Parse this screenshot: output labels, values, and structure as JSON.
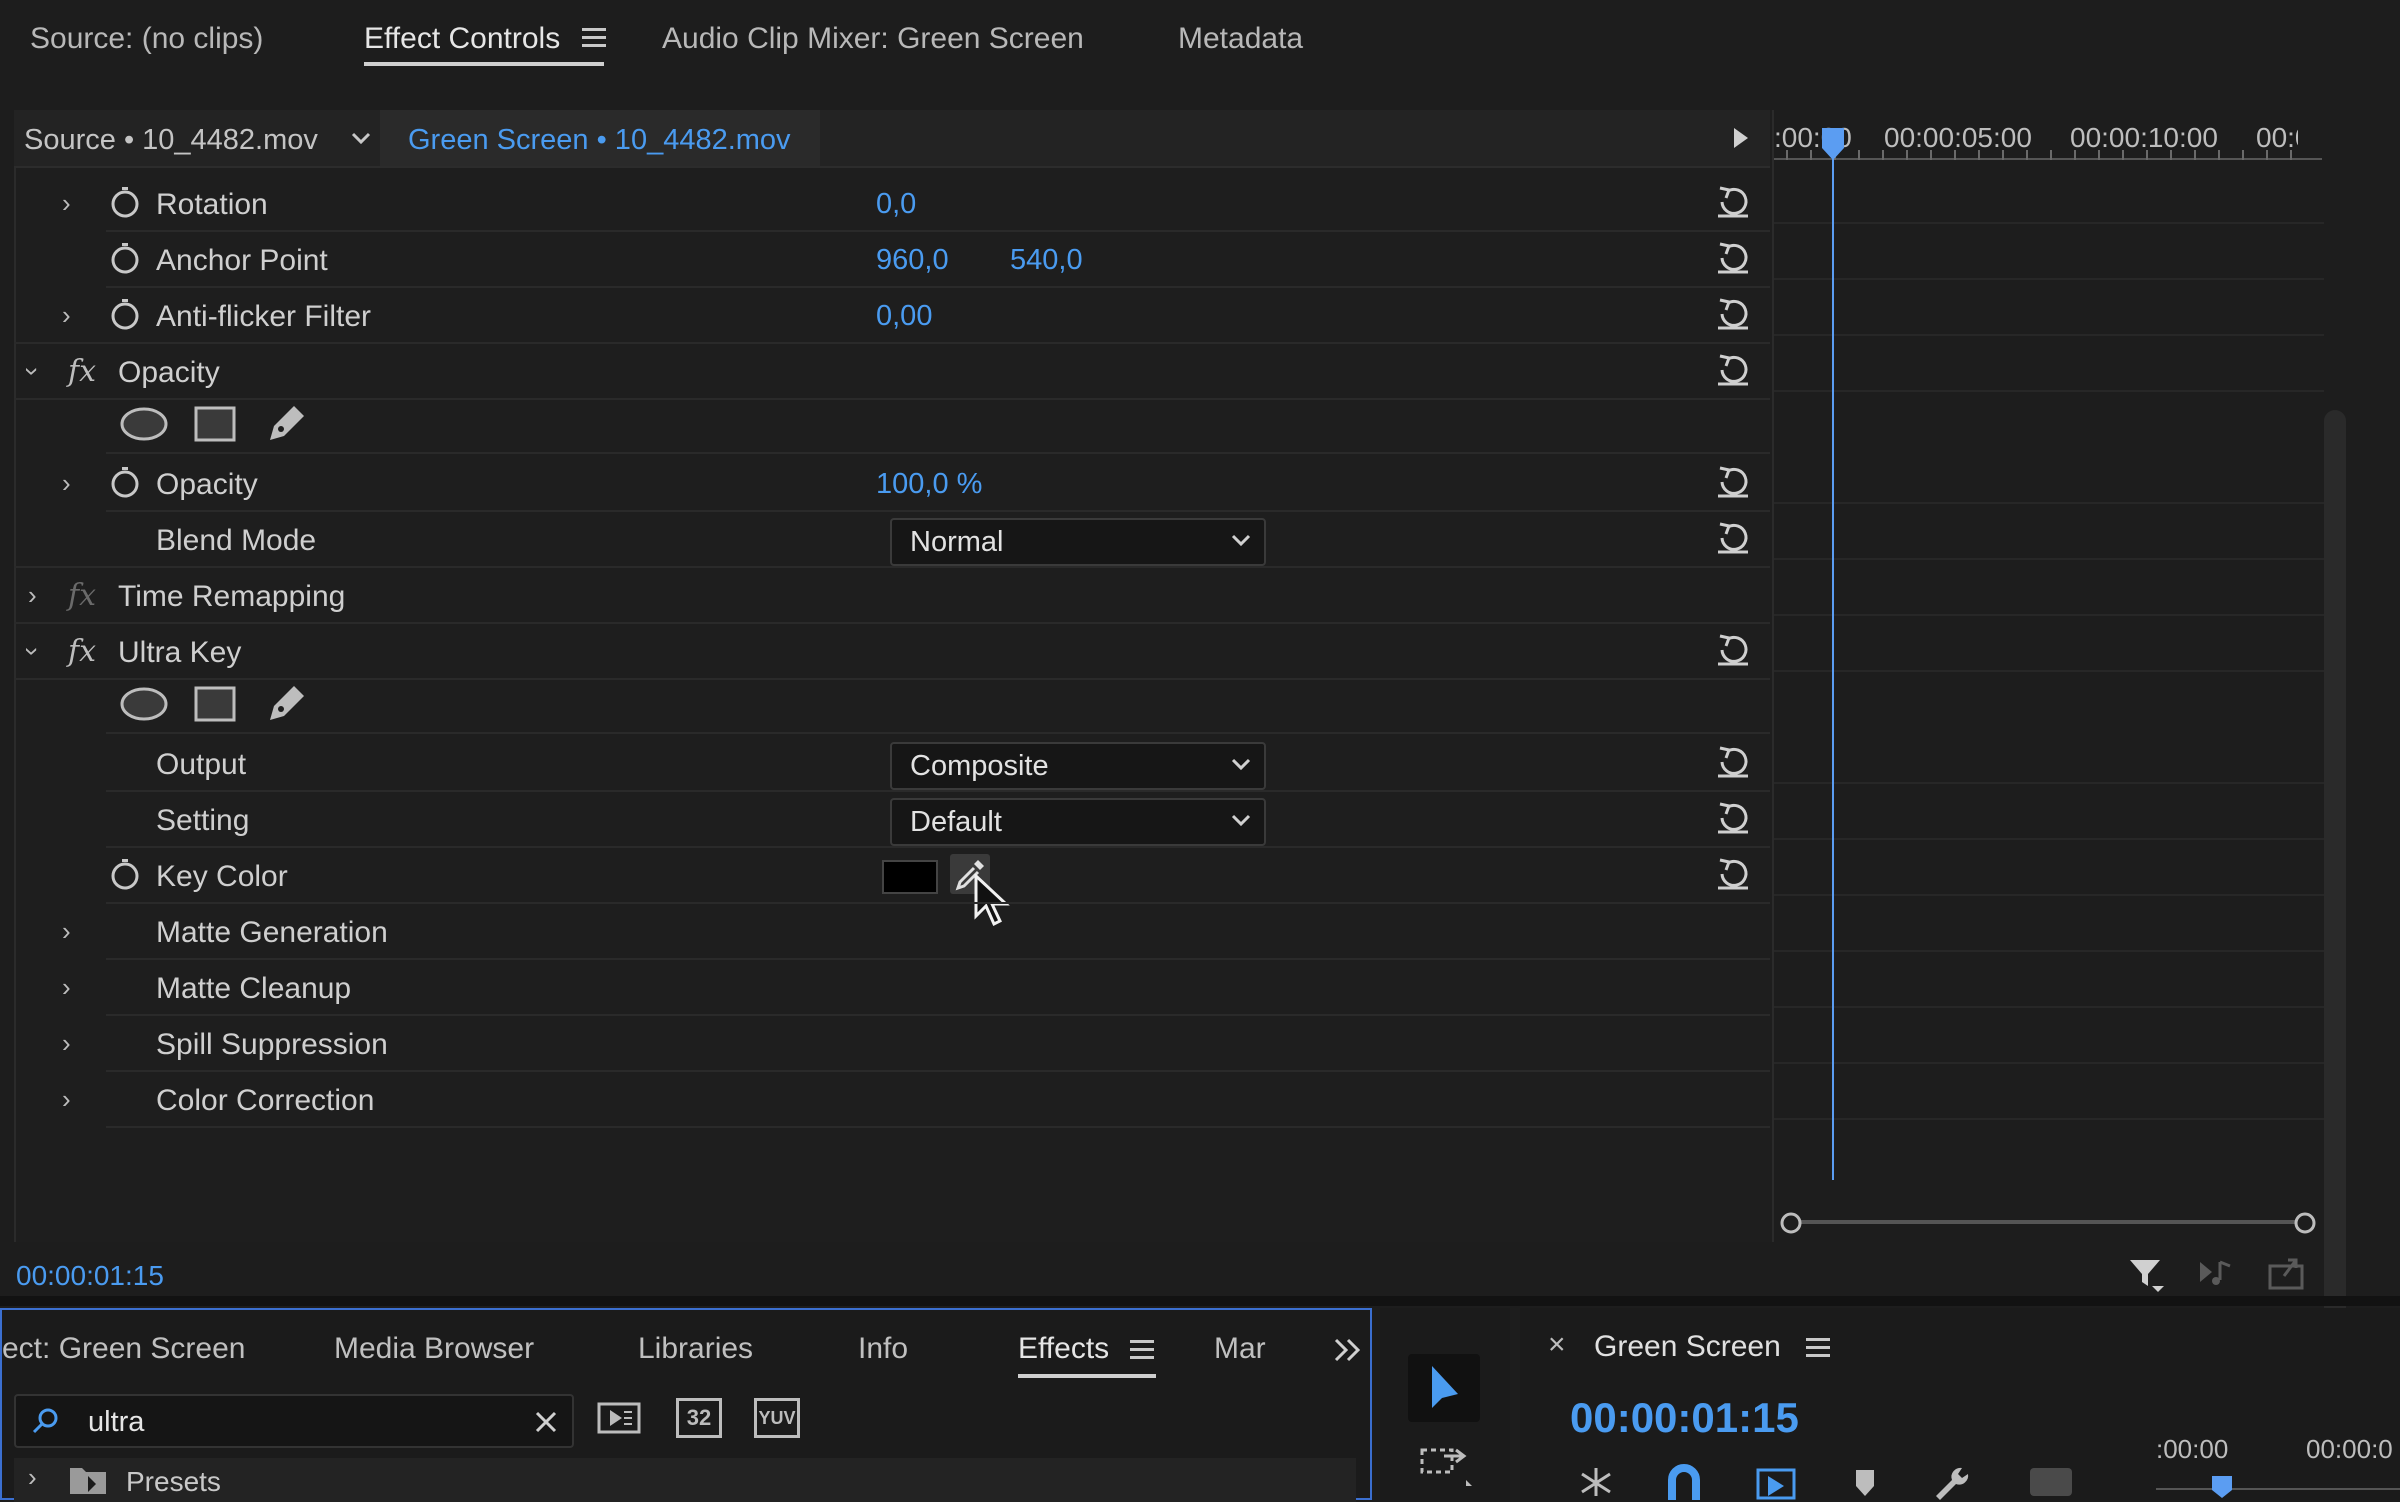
{
  "top_tabs": {
    "source": "Source: (no clips)",
    "effect_controls": "Effect Controls",
    "audio_mixer": "Audio Clip Mixer: Green Screen",
    "metadata": "Metadata"
  },
  "source_bar": {
    "master": "Source • 10_4482.mov",
    "clip": "Green Screen • 10_4482.mov"
  },
  "ruler": {
    "t0": ":00:00",
    "t1": "00:00:05:00",
    "t2": "00:00:10:00",
    "t3": "00:0("
  },
  "rows": {
    "rotation": {
      "name": "Rotation",
      "value": "0,0"
    },
    "anchor": {
      "name": "Anchor Point",
      "value_x": "960,0",
      "value_y": "540,0"
    },
    "antiflicker": {
      "name": "Anti-flicker Filter",
      "value": "0,00"
    },
    "opacity_group": {
      "name": "Opacity"
    },
    "opacity": {
      "name": "Opacity",
      "value": "100,0 %"
    },
    "blend": {
      "name": "Blend Mode",
      "value": "Normal"
    },
    "time_remap": {
      "name": "Time Remapping"
    },
    "ultra_key": {
      "name": "Ultra Key"
    },
    "output": {
      "name": "Output",
      "value": "Composite"
    },
    "setting": {
      "name": "Setting",
      "value": "Default"
    },
    "key_color": {
      "name": "Key Color",
      "swatch": "#000000"
    },
    "matte_gen": {
      "name": "Matte Generation"
    },
    "matte_cleanup": {
      "name": "Matte Cleanup"
    },
    "spill": {
      "name": "Spill Suppression"
    },
    "color_corr": {
      "name": "Color Correction"
    }
  },
  "fx_symbol": "fx",
  "current_time": "00:00:01:15",
  "bottom_tabs": {
    "project": "ect: Green Screen",
    "media_browser": "Media Browser",
    "libraries": "Libraries",
    "info": "Info",
    "effects": "Effects",
    "markers": "Mar"
  },
  "search": {
    "value": "ultra"
  },
  "preset_icons": {
    "i32": "32",
    "yuv": "YUV"
  },
  "presets_label": "Presets",
  "sequence": {
    "close": "×",
    "name": "Green Screen",
    "timecode": "00:00:01:15",
    "ruler_a": ":00:00",
    "ruler_b": "00:00:0"
  },
  "colors": {
    "accent": "#4a9bf0",
    "background": "#1d1d1d",
    "panel_focus": "#3b6fd0"
  }
}
